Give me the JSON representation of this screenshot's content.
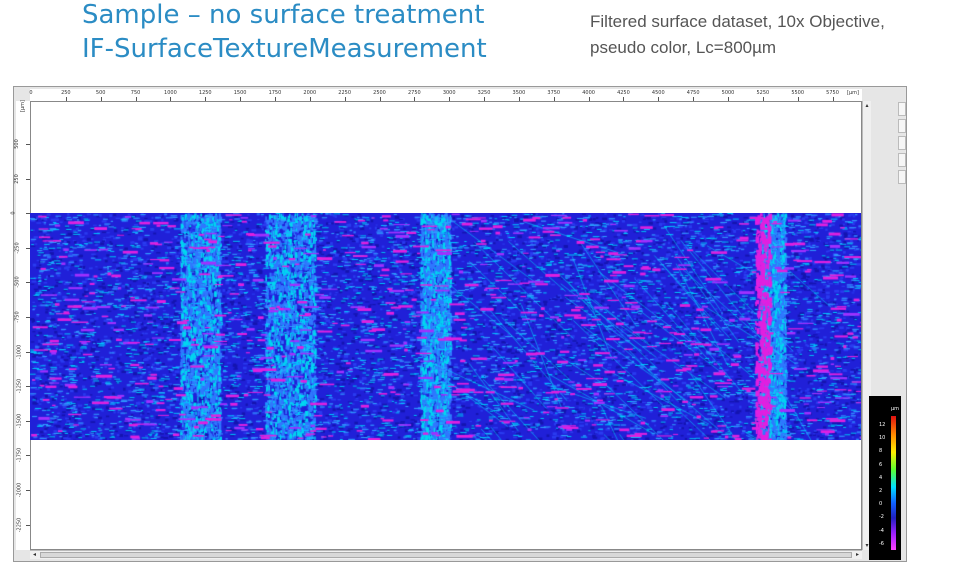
{
  "title": {
    "line1": "Sample – no surface treatment",
    "line2": "IF-SurfaceTextureMeasurement"
  },
  "description": {
    "line1": "Filtered surface dataset,  10x Objective,",
    "line2": "pseudo color, Lc=800µm"
  },
  "viewer": {
    "x_unit": "[µm]",
    "y_unit": "[µm]",
    "x_ticks": [
      "250",
      "500",
      "750",
      "1000",
      "1250",
      "1500",
      "1750",
      "2000",
      "2250",
      "2500",
      "2750",
      "3000",
      "3250",
      "3500",
      "3750",
      "4000",
      "4250",
      "4500",
      "4750",
      "5000",
      "5250",
      "5500",
      "5750"
    ],
    "x_first": "0",
    "y_ticks": [
      "500",
      "250",
      "0",
      "-250",
      "-500",
      "-750",
      "-1000",
      "-1250",
      "-1500",
      "-1750",
      "-2000",
      "-2250"
    ],
    "scroll_left": "◂",
    "scroll_right": "▸",
    "scroll_up": "▴",
    "scroll_down": "▾"
  },
  "legend": {
    "unit": "µm",
    "ticks": [
      "12",
      "10",
      "8",
      "6",
      "4",
      "2",
      "0",
      "-2",
      "-4",
      "-6"
    ]
  },
  "colors": {
    "title": "#2b8cc4",
    "surface_base": "#2020d8",
    "surface_cyan": "#00d8f0",
    "surface_magenta": "#e020e0"
  }
}
